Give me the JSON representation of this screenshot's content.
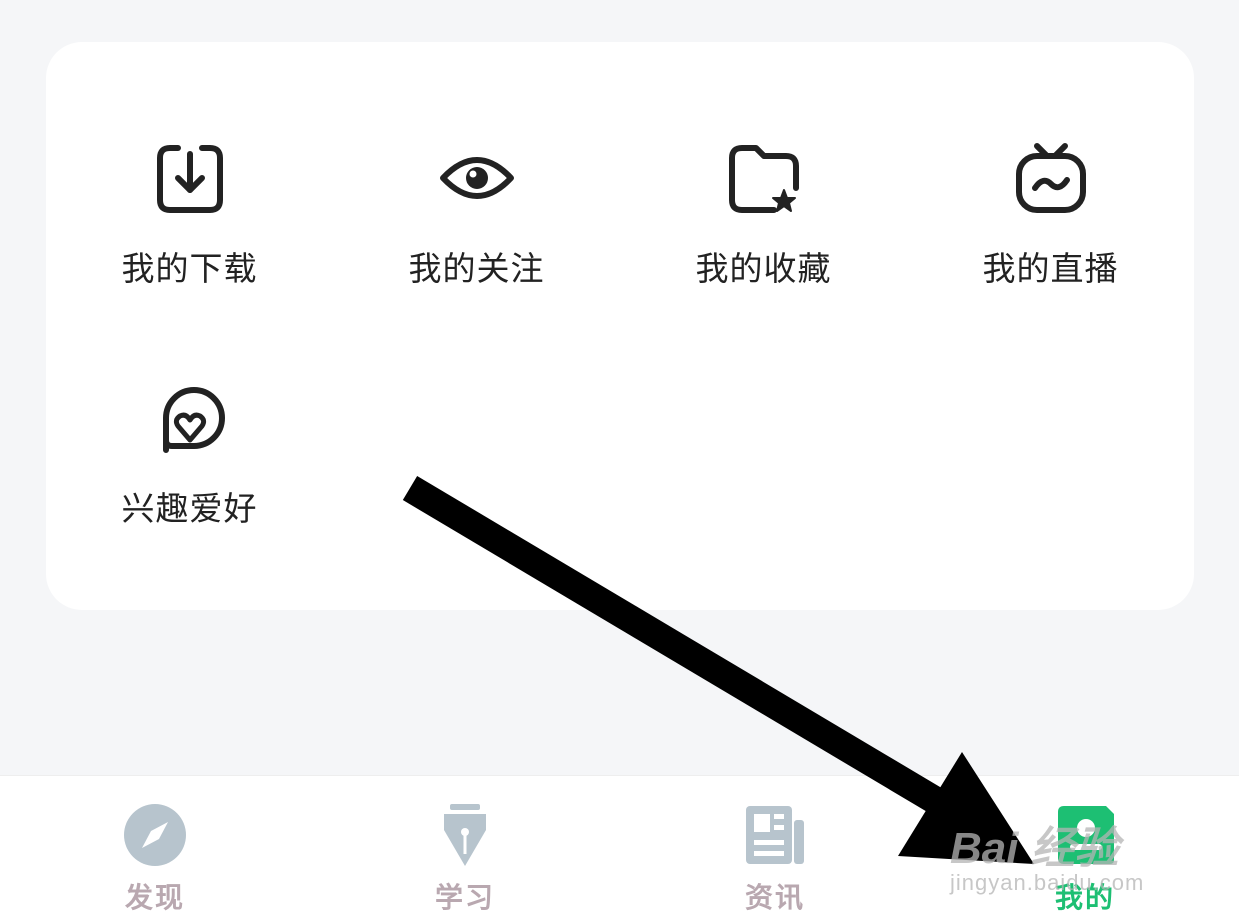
{
  "grid": {
    "items": [
      {
        "label": "我的下载",
        "icon": "download-icon"
      },
      {
        "label": "我的关注",
        "icon": "eye-icon"
      },
      {
        "label": "我的收藏",
        "icon": "folder-star-icon"
      },
      {
        "label": "我的直播",
        "icon": "tv-icon"
      },
      {
        "label": "兴趣爱好",
        "icon": "heart-bubble-icon"
      }
    ]
  },
  "tabbar": {
    "tabs": [
      {
        "label": "发现",
        "icon": "compass-icon",
        "active": false
      },
      {
        "label": "学习",
        "icon": "pen-nib-icon",
        "active": false
      },
      {
        "label": "资讯",
        "icon": "news-icon",
        "active": false
      },
      {
        "label": "我的",
        "icon": "profile-icon",
        "active": true
      }
    ],
    "active_color": "#1dbf73",
    "inactive_color": "#b9a8b0"
  },
  "watermark": {
    "brand": "Bai 经验",
    "url": "jingyan.baidu.com"
  },
  "colors": {
    "background": "#f5f6f8",
    "card": "#ffffff",
    "icon_stroke": "#222222",
    "annotation_arrow": "#000000"
  }
}
